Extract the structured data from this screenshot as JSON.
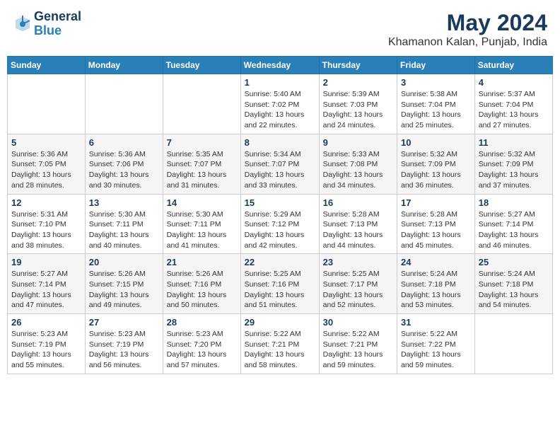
{
  "header": {
    "logo_line1": "General",
    "logo_line2": "Blue",
    "title": "May 2024",
    "subtitle": "Khamanon Kalan, Punjab, India"
  },
  "days_of_week": [
    "Sunday",
    "Monday",
    "Tuesday",
    "Wednesday",
    "Thursday",
    "Friday",
    "Saturday"
  ],
  "weeks": [
    [
      {
        "day": "",
        "info": ""
      },
      {
        "day": "",
        "info": ""
      },
      {
        "day": "",
        "info": ""
      },
      {
        "day": "1",
        "info": "Sunrise: 5:40 AM\nSunset: 7:02 PM\nDaylight: 13 hours\nand 22 minutes."
      },
      {
        "day": "2",
        "info": "Sunrise: 5:39 AM\nSunset: 7:03 PM\nDaylight: 13 hours\nand 24 minutes."
      },
      {
        "day": "3",
        "info": "Sunrise: 5:38 AM\nSunset: 7:04 PM\nDaylight: 13 hours\nand 25 minutes."
      },
      {
        "day": "4",
        "info": "Sunrise: 5:37 AM\nSunset: 7:04 PM\nDaylight: 13 hours\nand 27 minutes."
      }
    ],
    [
      {
        "day": "5",
        "info": "Sunrise: 5:36 AM\nSunset: 7:05 PM\nDaylight: 13 hours\nand 28 minutes."
      },
      {
        "day": "6",
        "info": "Sunrise: 5:36 AM\nSunset: 7:06 PM\nDaylight: 13 hours\nand 30 minutes."
      },
      {
        "day": "7",
        "info": "Sunrise: 5:35 AM\nSunset: 7:07 PM\nDaylight: 13 hours\nand 31 minutes."
      },
      {
        "day": "8",
        "info": "Sunrise: 5:34 AM\nSunset: 7:07 PM\nDaylight: 13 hours\nand 33 minutes."
      },
      {
        "day": "9",
        "info": "Sunrise: 5:33 AM\nSunset: 7:08 PM\nDaylight: 13 hours\nand 34 minutes."
      },
      {
        "day": "10",
        "info": "Sunrise: 5:32 AM\nSunset: 7:09 PM\nDaylight: 13 hours\nand 36 minutes."
      },
      {
        "day": "11",
        "info": "Sunrise: 5:32 AM\nSunset: 7:09 PM\nDaylight: 13 hours\nand 37 minutes."
      }
    ],
    [
      {
        "day": "12",
        "info": "Sunrise: 5:31 AM\nSunset: 7:10 PM\nDaylight: 13 hours\nand 38 minutes."
      },
      {
        "day": "13",
        "info": "Sunrise: 5:30 AM\nSunset: 7:11 PM\nDaylight: 13 hours\nand 40 minutes."
      },
      {
        "day": "14",
        "info": "Sunrise: 5:30 AM\nSunset: 7:11 PM\nDaylight: 13 hours\nand 41 minutes."
      },
      {
        "day": "15",
        "info": "Sunrise: 5:29 AM\nSunset: 7:12 PM\nDaylight: 13 hours\nand 42 minutes."
      },
      {
        "day": "16",
        "info": "Sunrise: 5:28 AM\nSunset: 7:13 PM\nDaylight: 13 hours\nand 44 minutes."
      },
      {
        "day": "17",
        "info": "Sunrise: 5:28 AM\nSunset: 7:13 PM\nDaylight: 13 hours\nand 45 minutes."
      },
      {
        "day": "18",
        "info": "Sunrise: 5:27 AM\nSunset: 7:14 PM\nDaylight: 13 hours\nand 46 minutes."
      }
    ],
    [
      {
        "day": "19",
        "info": "Sunrise: 5:27 AM\nSunset: 7:14 PM\nDaylight: 13 hours\nand 47 minutes."
      },
      {
        "day": "20",
        "info": "Sunrise: 5:26 AM\nSunset: 7:15 PM\nDaylight: 13 hours\nand 49 minutes."
      },
      {
        "day": "21",
        "info": "Sunrise: 5:26 AM\nSunset: 7:16 PM\nDaylight: 13 hours\nand 50 minutes."
      },
      {
        "day": "22",
        "info": "Sunrise: 5:25 AM\nSunset: 7:16 PM\nDaylight: 13 hours\nand 51 minutes."
      },
      {
        "day": "23",
        "info": "Sunrise: 5:25 AM\nSunset: 7:17 PM\nDaylight: 13 hours\nand 52 minutes."
      },
      {
        "day": "24",
        "info": "Sunrise: 5:24 AM\nSunset: 7:18 PM\nDaylight: 13 hours\nand 53 minutes."
      },
      {
        "day": "25",
        "info": "Sunrise: 5:24 AM\nSunset: 7:18 PM\nDaylight: 13 hours\nand 54 minutes."
      }
    ],
    [
      {
        "day": "26",
        "info": "Sunrise: 5:23 AM\nSunset: 7:19 PM\nDaylight: 13 hours\nand 55 minutes."
      },
      {
        "day": "27",
        "info": "Sunrise: 5:23 AM\nSunset: 7:19 PM\nDaylight: 13 hours\nand 56 minutes."
      },
      {
        "day": "28",
        "info": "Sunrise: 5:23 AM\nSunset: 7:20 PM\nDaylight: 13 hours\nand 57 minutes."
      },
      {
        "day": "29",
        "info": "Sunrise: 5:22 AM\nSunset: 7:21 PM\nDaylight: 13 hours\nand 58 minutes."
      },
      {
        "day": "30",
        "info": "Sunrise: 5:22 AM\nSunset: 7:21 PM\nDaylight: 13 hours\nand 59 minutes."
      },
      {
        "day": "31",
        "info": "Sunrise: 5:22 AM\nSunset: 7:22 PM\nDaylight: 13 hours\nand 59 minutes."
      },
      {
        "day": "",
        "info": ""
      }
    ]
  ]
}
